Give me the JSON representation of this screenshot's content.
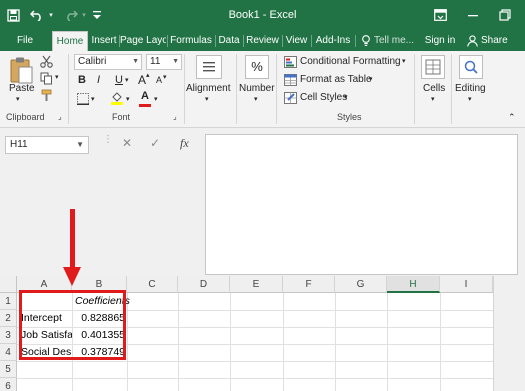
{
  "title_bar": {
    "title": "Book1 - Excel",
    "save_icon": "save-icon",
    "undo_icon": "undo-icon",
    "redo_icon": "redo-icon",
    "customize_icon": "customize-qat-icon",
    "ribbon_display_icon": "ribbon-display-options-icon",
    "minimize_icon": "minimize-icon",
    "restore_icon": "restore-icon"
  },
  "tabs": {
    "file": "File",
    "home": "Home",
    "insert": "Insert",
    "page_layout": "Page Layo",
    "formulas": "Formulas",
    "data": "Data",
    "review": "Review",
    "view": "View",
    "add_ins": "Add-Ins",
    "tell_me": "Tell me...",
    "sign_in": "Sign in",
    "share": "Share"
  },
  "ribbon": {
    "clipboard": {
      "paste": "Paste",
      "label": "Clipboard"
    },
    "font": {
      "label": "Font",
      "font_name": "Calibri",
      "font_size": "11",
      "bold": "B",
      "italic": "I",
      "underline": "U",
      "grow": "A",
      "shrink": "A",
      "font_color": "A"
    },
    "alignment": {
      "label": "Alignment"
    },
    "number": {
      "label": "Number",
      "symbol": "%"
    },
    "styles": {
      "label": "Styles",
      "conditional": "Conditional Formatting",
      "format_table": "Format as Table",
      "cell_styles": "Cell Styles"
    },
    "cells": {
      "label": "Cells"
    },
    "editing": {
      "label": "Editing"
    }
  },
  "formula_bar": {
    "name_box": "H11",
    "cancel": "✕",
    "enter": "✓",
    "fx": "fx",
    "value": ""
  },
  "grid": {
    "columns": [
      "A",
      "B",
      "C",
      "D",
      "E",
      "F",
      "G",
      "H",
      "I"
    ],
    "selected_column": "H",
    "rows": [
      "1",
      "2",
      "3",
      "4",
      "5",
      "6"
    ],
    "cells": {
      "B1": "Coefficients",
      "A2": "Intercept",
      "B2": "0.828865",
      "A3": "Job Satisfa",
      "B3": "0.401355",
      "A4": "Social Des",
      "B4": "0.378749"
    }
  },
  "annotation": {
    "color": "#e11b1b"
  },
  "colors": {
    "excel_green": "#217346"
  }
}
